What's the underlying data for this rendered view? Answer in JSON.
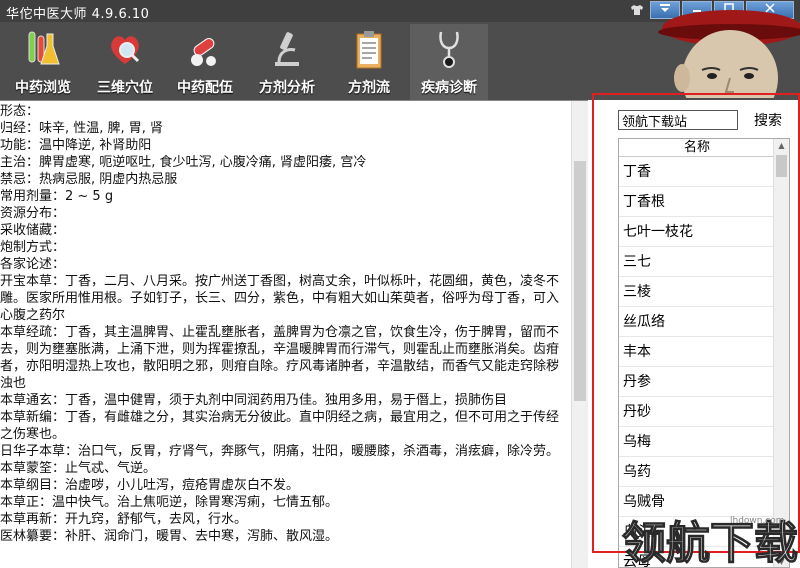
{
  "window": {
    "title": "华佗中医大师 4.9.6.10"
  },
  "toolbar": {
    "items": [
      {
        "label": "中药浏览"
      },
      {
        "label": "三维穴位"
      },
      {
        "label": "中药配伍"
      },
      {
        "label": "方剂分析"
      },
      {
        "label": "方剂流"
      },
      {
        "label": "疾病诊断"
      }
    ]
  },
  "content": {
    "lines": [
      "形态：",
      "归经：味辛, 性温, 脾, 胃, 肾",
      "功能：温中降逆, 补肾助阳",
      "主治：脾胃虚寒, 呃逆呕吐, 食少吐泻, 心腹冷痛, 肾虚阳痿, 宫冷",
      "禁忌：热病忌服, 阴虚内热忌服",
      "常用剂量：2 ~ 5 g",
      "资源分布：",
      "采收储藏：",
      "炮制方式：",
      "各家论述：",
      "开宝本草：丁香，二月、八月采。按广州送丁香图，树高丈余，叶似栎叶，花圆细，黄色，凌冬不雕。医家所用惟用根。子如钉子，长三、四分，紫色，中有粗大如山茱萸者，俗呼为母丁香，可入心腹之药尔",
      "本草经疏：丁香，其主温脾胃、止霍乱壅胀者，盖脾胃为仓凛之官，饮食生冷，伤于脾胃，留而不去，则为壅塞胀满，上涌下泄，则为挥霍撩乱，辛温暖脾胃而行滞气，则霍乱止而壅胀消矣。齿疳者，亦阳明湿热上攻也，散阳明之邪，则疳自除。疗风毒诸肿者，辛温散结，而香气又能走窍除秽浊也",
      "本草通玄：丁香，温中健胃，须于丸剂中同润药用乃佳。独用多用，易于僭上，损肺伤目",
      "本草新编：丁香，有雌雄之分，其实治病无分彼此。直中阴经之病，最宜用之，但不可用之于传经之伤寒也。",
      "日华子本草：治口气，反胃，疗肾气，奔豚气，阴痛，壮阳，暖腰膝，杀酒毒，消痃癖，除冷劳。",
      "本草蒙筌：止气忒、气逆。",
      "本草纲目：治虚哕，小儿吐泻，痘疮胃虚灰白不发。",
      "本草正：温中快气。治上焦呃逆，除胃寒泻痢，七情五郁。",
      "本草再新：开九窍，舒郁气，去风，行水。",
      "医林纂要：补肝、润命门，暖胃、去中寒，泻肺、散风湿。"
    ]
  },
  "search": {
    "value": "领航下载站",
    "button_label": "搜索"
  },
  "list": {
    "header": "名称",
    "items": [
      "丁香",
      "丁香根",
      "七叶一枝花",
      "三七",
      "三棱",
      "丝瓜络",
      "丰本",
      "丹参",
      "丹砂",
      "乌梅",
      "乌药",
      "乌贼骨",
      "乌头",
      "云母"
    ]
  },
  "watermark": {
    "brand": "领航下载",
    "site": "lhdown.com"
  },
  "icons": {
    "shirt": "shirt-icon",
    "menu": "menu-down-icon",
    "minimize": "minimize-icon",
    "maximize": "maximize-icon",
    "close": "close-icon",
    "scroll_up": "arrow-up-icon",
    "scroll_down": "arrow-down-icon"
  },
  "colors": {
    "titlebar": "#3f3f3f",
    "toolbar": "#4d4d4d",
    "highlight": "#e02020",
    "window_button": "#3a6fb0"
  }
}
